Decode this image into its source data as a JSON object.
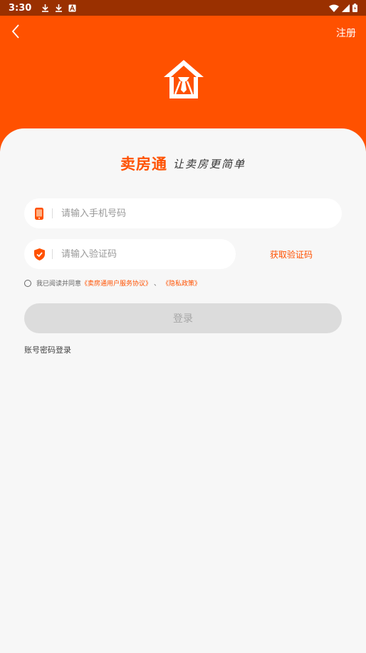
{
  "status_bar": {
    "time": "3:30",
    "left_icons": [
      "download-icon",
      "download-icon",
      "font-icon"
    ],
    "right_icons": [
      "wifi-icon",
      "signal-icon",
      "battery-icon"
    ]
  },
  "header": {
    "back_icon": "chevron-left-icon",
    "register_label": "注册",
    "logo_icon": "house-tie-icon",
    "color": "#ff5100"
  },
  "brand": {
    "name": "卖房通",
    "slogan": "让卖房更简单"
  },
  "form": {
    "phone": {
      "value": "",
      "placeholder": "请输入手机号码",
      "icon": "phone-icon"
    },
    "code": {
      "value": "",
      "placeholder": "请输入验证码",
      "icon": "shield-check-icon"
    },
    "get_code_label": "获取验证码"
  },
  "agreement": {
    "prefix": "我已阅读并同意",
    "user_agreement": "《卖房通用户服务协议》",
    "separator": "、",
    "privacy_policy": "《隐私政策》"
  },
  "login_label": "登录",
  "password_login_label": "账号密码登录",
  "colors": {
    "accent": "#ff5100",
    "status_bar": "#9a3000",
    "disabled_button": "#dcdcdc",
    "background": "#f7f7f7"
  }
}
